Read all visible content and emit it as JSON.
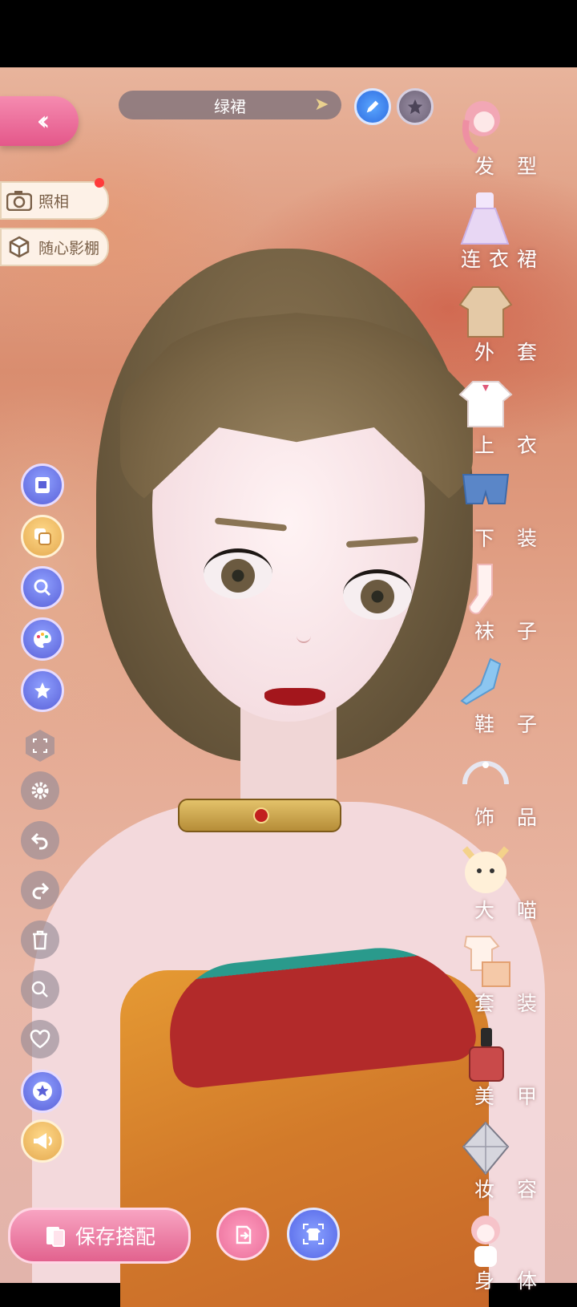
{
  "outfit": {
    "name": "绿裙"
  },
  "left_menu": {
    "photo_label": "照相",
    "studio_label": "随心影棚"
  },
  "categories": [
    {
      "label": "发 型",
      "icon": "hairstyle-icon",
      "color": "#f2a7b5"
    },
    {
      "label": "连衣裙",
      "icon": "dress-icon",
      "color": "#e8d7f4"
    },
    {
      "label": "外 套",
      "icon": "coat-icon",
      "color": "#d8b48a"
    },
    {
      "label": "上 衣",
      "icon": "top-icon",
      "color": "#ffffff"
    },
    {
      "label": "下 装",
      "icon": "bottoms-icon",
      "color": "#5a86c8"
    },
    {
      "label": "袜 子",
      "icon": "socks-icon",
      "color": "#fff2f0"
    },
    {
      "label": "鞋 子",
      "icon": "shoes-icon",
      "color": "#8cc6f0"
    },
    {
      "label": "饰 品",
      "icon": "accessory-icon",
      "color": "#e6e6f0"
    },
    {
      "label": "大 喵",
      "icon": "cat-icon",
      "color": "#fff0d8"
    },
    {
      "label": "套 装",
      "icon": "set-icon",
      "color": "#f5c9a8"
    },
    {
      "label": "美 甲",
      "icon": "nail-polish-icon",
      "color": "#c94a4a"
    },
    {
      "label": "妆 容",
      "icon": "makeup-icon",
      "color": "#b0b0b8"
    },
    {
      "label": "身 体",
      "icon": "body-icon",
      "color": "#f6c3c9"
    }
  ],
  "bottom": {
    "save_label": "保存搭配"
  }
}
